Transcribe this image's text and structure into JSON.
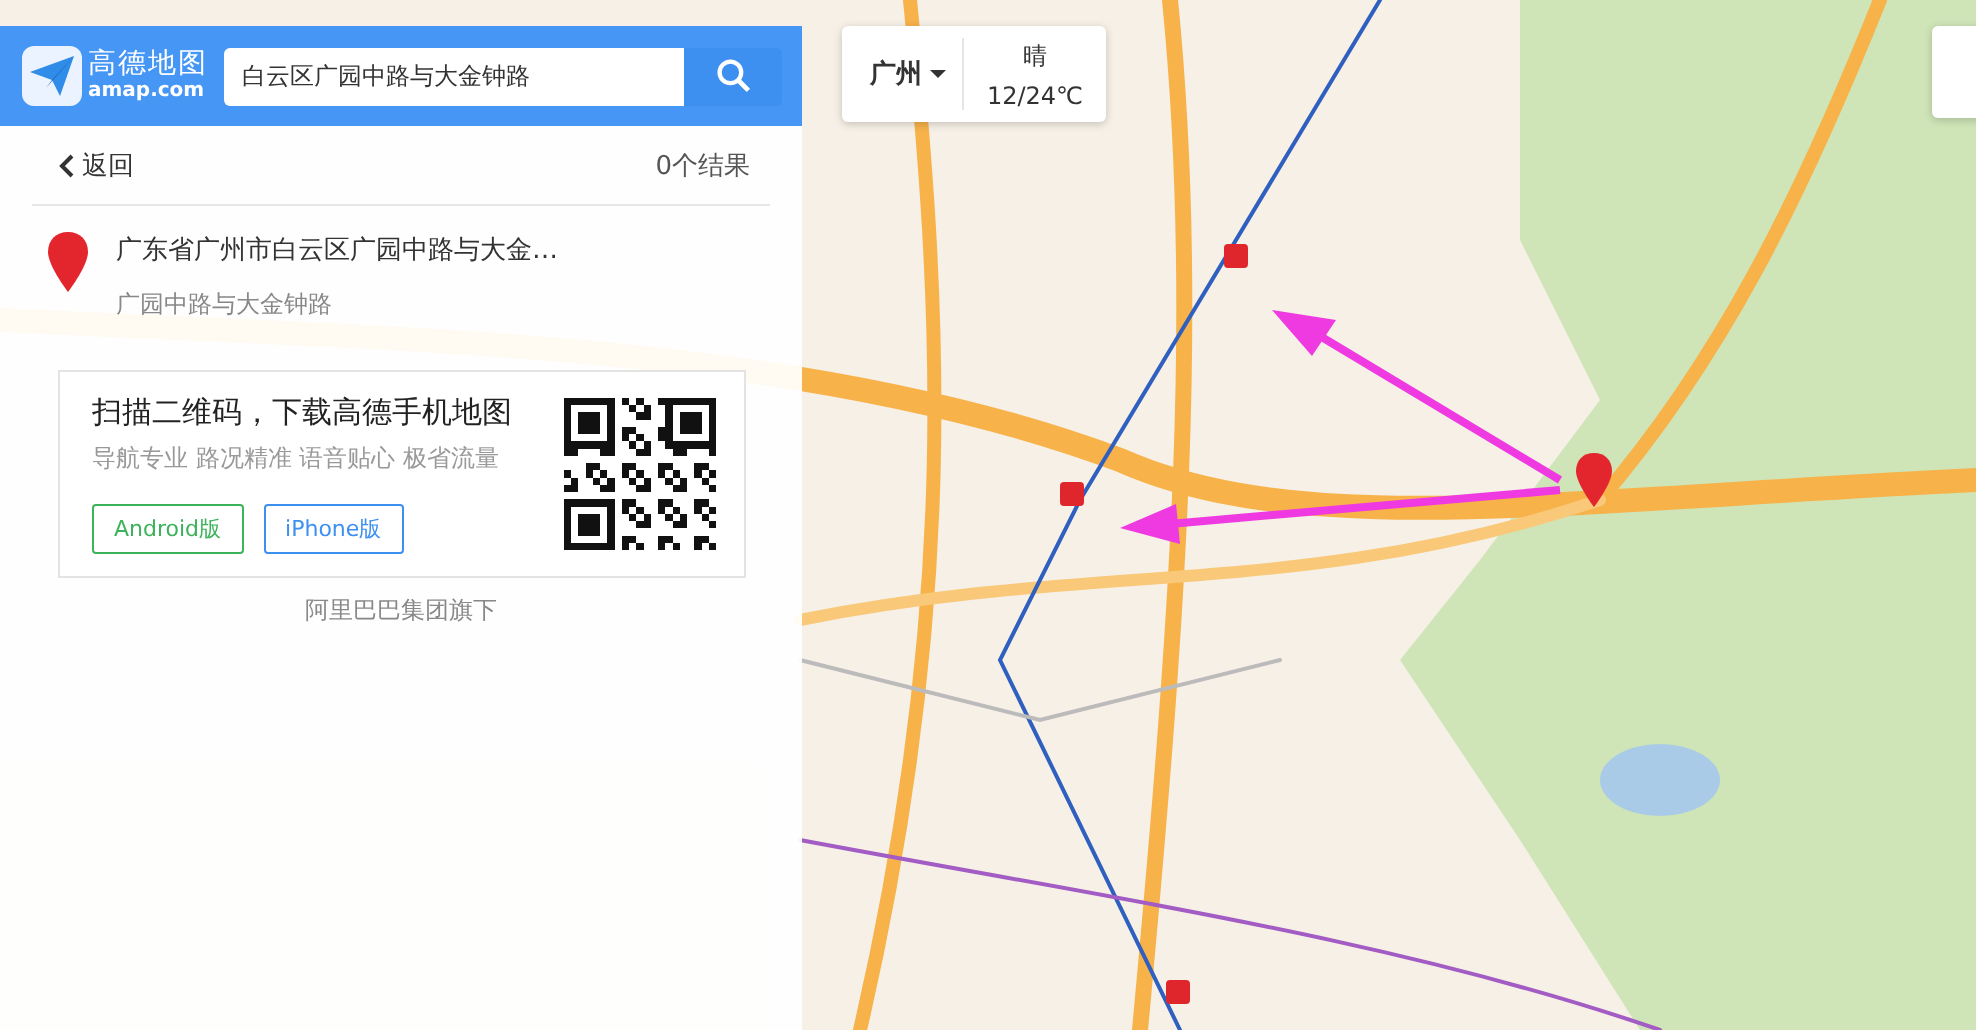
{
  "logo": {
    "name": "高德地图",
    "domain": "amap.com"
  },
  "search": {
    "value": "白云区广园中路与大金钟路"
  },
  "back": "返回",
  "result_count": "0个结果",
  "results": [
    {
      "title": "广东省广州市白云区广园中路与大金…",
      "subtitle": "广园中路与大金钟路"
    }
  ],
  "promo": {
    "title": "扫描二维码，下载高德手机地图",
    "features": "导航专业 路况精准 语音贴心 极省流量",
    "buttons": [
      {
        "label": "Android版",
        "color": "#3cb25a"
      },
      {
        "label": "iPhone版",
        "color": "#3d8ff0"
      }
    ]
  },
  "footer": "阿里巴巴集团旗下",
  "weather": {
    "city": "广州",
    "condition": "晴",
    "temperature": "12/24℃"
  }
}
